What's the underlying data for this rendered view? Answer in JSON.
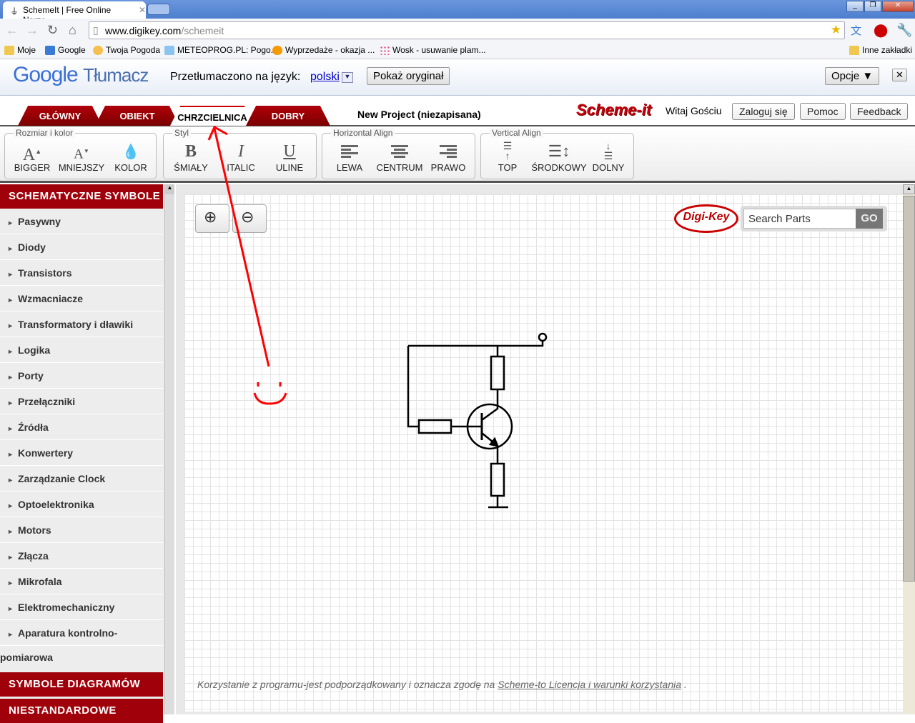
{
  "browser": {
    "tab_title": "SchemeIt | Free Online Narzę",
    "url_host": "www.digikey.com",
    "url_path": "/schemeit",
    "bookmarks": [
      "Moje",
      "Google",
      "Twoja Pogoda",
      "METEOPROG.PL: Pogo...",
      "Wyprzedaże - okazja ...",
      "Wosk - usuwanie plam..."
    ],
    "other_bookmarks": "Inne zakładki"
  },
  "translate": {
    "logo_google": "Google",
    "logo_product": "Tłumacz",
    "label": "Przetłumaczono na język:",
    "language": "polski",
    "show_original": "Pokaż oryginał",
    "options": "Opcje ▼",
    "close": "✕"
  },
  "app": {
    "tabs": [
      "GŁÓWNY",
      "OBIEKT",
      "CHRZCIELNICA",
      "DOBRY"
    ],
    "project_title": "New Project (niezapisana)",
    "logo": "Scheme-it",
    "greeting": "Witaj Gościu",
    "login": "Zaloguj się",
    "help": "Pomoc",
    "feedback": "Feedback"
  },
  "toolbar": {
    "groups": [
      {
        "label": "Rozmiar i kolor",
        "buttons": [
          "BIGGER",
          "MNIEJSZY",
          "KOLOR"
        ]
      },
      {
        "label": "Styl",
        "buttons": [
          "ŚMIAŁY",
          "ITALIC",
          "ULINE"
        ]
      },
      {
        "label": "Horizontal Align",
        "buttons": [
          "LEWA",
          "CENTRUM",
          "PRAWO"
        ]
      },
      {
        "label": "Vertical Align",
        "buttons": [
          "TOP",
          "ŚRODKOWY",
          "DOLNY"
        ]
      }
    ]
  },
  "sidebar": {
    "header": "SCHEMATYCZNE SYMBOLE",
    "items": [
      "Pasywny",
      "Diody",
      "Transistors",
      "Wzmacniacze",
      "Transformatory i dławiki",
      "Logika",
      "Porty",
      "Przełączniki",
      "Źródła",
      "Konwertery",
      "Zarządzanie Clock",
      "Optoelektronika",
      "Motors",
      "Złącza",
      "Mikrofala",
      "Elektromechaniczny",
      "Aparatura kontrolno-"
    ],
    "item_wrap": "pomiarowa",
    "header2": "SYMBOLE DIAGRAMÓW",
    "header3": "NIESTANDARDOWE"
  },
  "canvas": {
    "search_placeholder": "Search Parts",
    "go": "GO",
    "brand": "Digi-Key",
    "footer_text": "Korzystanie z programu-jest podporządkowany i oznacza zgodę na ",
    "footer_link": "Scheme-to Licencja i warunki korzystania",
    "footer_end": " ."
  },
  "colors": {
    "brand_red": "#a0000a",
    "annotation": "#ff0000"
  }
}
